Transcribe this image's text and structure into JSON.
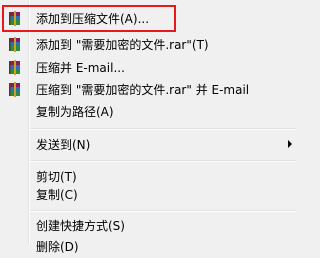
{
  "menu": {
    "items": [
      {
        "label": "添加到压缩文件(A)...",
        "icon": "winrar-archive-icon"
      },
      {
        "label": "添加到 \"需要加密的文件.rar\"(T)",
        "icon": "winrar-archive-icon"
      },
      {
        "label": "压缩并 E-mail...",
        "icon": "winrar-archive-icon"
      },
      {
        "label": "压缩到 \"需要加密的文件.rar\" 并 E-mail",
        "icon": "winrar-archive-icon"
      },
      {
        "label": "复制为路径(A)"
      },
      {
        "label": "发送到(N)",
        "has_submenu": true
      },
      {
        "label": "剪切(T)"
      },
      {
        "label": "复制(C)"
      },
      {
        "label": "创建快捷方式(S)"
      },
      {
        "label": "删除(D)"
      }
    ]
  },
  "colors": {
    "highlight_border": "#e8191c",
    "menu_background": "#f0f0f0"
  }
}
